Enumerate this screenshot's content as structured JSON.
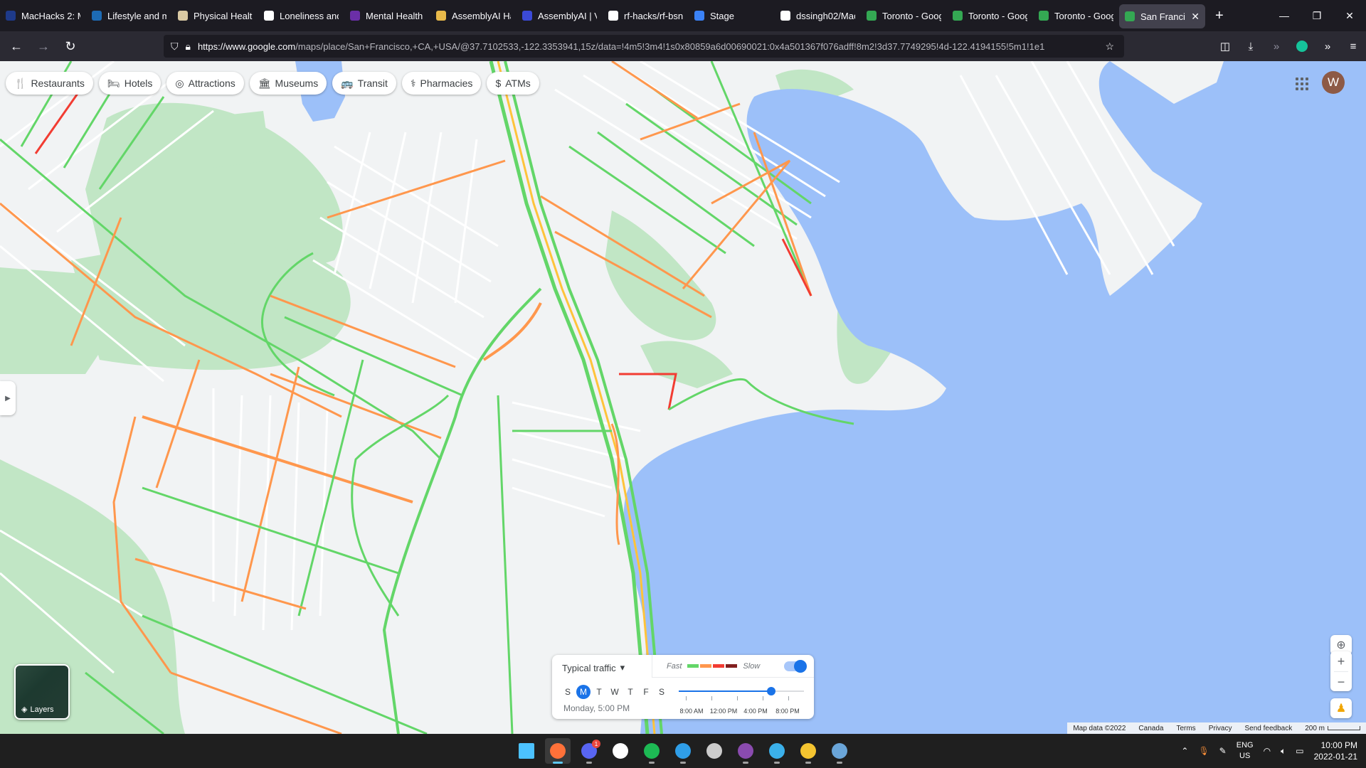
{
  "browser": {
    "tabs": [
      {
        "title": "MacHacks 2: M",
        "fav_color": "#1e3a8a",
        "icon": "d-letter-icon"
      },
      {
        "title": "Lifestyle and m",
        "fav_color": "#1d6bb5",
        "icon": "document-icon"
      },
      {
        "title": "Physical Health",
        "fav_color": "#d9c9a3",
        "icon": "pen-icon"
      },
      {
        "title": "Loneliness and",
        "fav_color": "#ffffff",
        "icon": "notion-icon"
      },
      {
        "title": "Mental Health",
        "fav_color": "#6b2fa8",
        "icon": "c-letter-icon"
      },
      {
        "title": "AssemblyAI Ha",
        "fav_color": "#e8b94a",
        "icon": "person-icon"
      },
      {
        "title": "AssemblyAI | V",
        "fav_color": "#3b4ad8",
        "icon": "assemblyai-icon"
      },
      {
        "title": "rf-hacks/rf-bsn",
        "fav_color": "#ffffff",
        "icon": "github-icon"
      },
      {
        "title": "Stage",
        "fav_color": "#3b82f6",
        "icon": "gear-icon"
      },
      {
        "title": "dssingh02/Mac",
        "fav_color": "#ffffff",
        "icon": "github-icon"
      },
      {
        "title": "Toronto - Goog",
        "fav_color": "#34a853",
        "icon": "maps-pin-icon"
      },
      {
        "title": "Toronto - Goog",
        "fav_color": "#34a853",
        "icon": "maps-pin-icon"
      },
      {
        "title": "Toronto - Goog",
        "fav_color": "#34a853",
        "icon": "maps-pin-icon"
      },
      {
        "title": "San Francisc",
        "fav_color": "#34a853",
        "icon": "maps-pin-icon",
        "active": true
      }
    ],
    "url_host": "https://www.google.com",
    "url_path": "/maps/place/San+Francisco,+CA,+USA/@37.7102533,-122.3353941,15z/data=!4m5!3m4!1s0x80859a6d00690021:0x4a501367f076adff!8m2!3d37.7749295!4d-122.4194155!5m1!1e1"
  },
  "map": {
    "chips": [
      {
        "label": "Restaurants",
        "icon": "fork-knife-icon",
        "glyph": "🍴"
      },
      {
        "label": "Hotels",
        "icon": "bed-icon",
        "glyph": "🛏"
      },
      {
        "label": "Attractions",
        "icon": "camera-icon",
        "glyph": "◎"
      },
      {
        "label": "Museums",
        "icon": "museum-icon",
        "glyph": "🏛"
      },
      {
        "label": "Transit",
        "icon": "bus-icon",
        "glyph": "🚌"
      },
      {
        "label": "Pharmacies",
        "icon": "pharmacy-icon",
        "glyph": "⚕"
      },
      {
        "label": "ATMs",
        "icon": "atm-icon",
        "glyph": "$"
      }
    ],
    "avatar_letter": "W",
    "layers_label": "Layers",
    "traffic": {
      "mode": "Typical traffic",
      "legend_fast": "Fast",
      "legend_slow": "Slow",
      "legend_colors": [
        "#63d668",
        "#ff974d",
        "#f23c32",
        "#811f1f"
      ],
      "days": [
        "S",
        "M",
        "T",
        "W",
        "T",
        "F",
        "S"
      ],
      "selected_day_index": 1,
      "selected_time": "Monday, 5:00 PM",
      "time_labels": [
        "8:00 AM",
        "12:00 PM",
        "4:00 PM",
        "8:00 PM"
      ],
      "slider_value": 0.74,
      "toggle_on": true
    },
    "colors": {
      "land": "#f1f3f4",
      "water": "#9cc0f9",
      "park": "#c1e6c5",
      "road_fast": "#63d668",
      "road_medium": "#ff974d",
      "road_slow": "#f23c32"
    },
    "attribution": [
      "Map data ©2022",
      "Canada",
      "Terms",
      "Privacy",
      "Send feedback"
    ],
    "scale": "200 m"
  },
  "taskbar": {
    "apps": [
      {
        "name": "start-icon",
        "color": "#4cc2ff"
      },
      {
        "name": "firefox-icon",
        "color": "#ff7139",
        "active": true
      },
      {
        "name": "discord-icon",
        "color": "#5865f2"
      },
      {
        "name": "notion-icon",
        "color": "#ffffff"
      },
      {
        "name": "spotify-icon",
        "color": "#1db954"
      },
      {
        "name": "vscode-icon",
        "color": "#2f9ee8"
      },
      {
        "name": "terminal-icon",
        "color": "#cccccc"
      },
      {
        "name": "github-desktop-icon",
        "color": "#8a4baf"
      },
      {
        "name": "notepad-icon",
        "color": "#3bb0ea"
      },
      {
        "name": "file-explorer-icon",
        "color": "#f4c430"
      },
      {
        "name": "image-viewer-icon",
        "color": "#6aa5d8"
      }
    ],
    "discord_badge": "1",
    "lang_top": "ENG",
    "lang_bottom": "US",
    "time": "10:00 PM",
    "date": "2022-01-21"
  }
}
